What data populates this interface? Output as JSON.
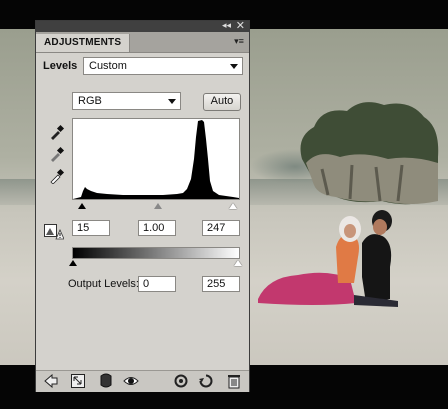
{
  "panel": {
    "tab_label": "ADJUSTMENTS",
    "titlebar_icons": [
      "collapse-icon",
      "close-icon"
    ],
    "menu_icon": "panel-menu-icon"
  },
  "levels": {
    "label": "Levels",
    "preset_value": "Custom",
    "channel_value": "RGB",
    "auto_label": "Auto",
    "input_black": "15",
    "input_gamma": "1.00",
    "input_white": "247",
    "output_label": "Output Levels:",
    "output_black": "0",
    "output_white": "255"
  },
  "tools": [
    "black-point-eyedropper-icon",
    "gray-point-eyedropper-icon",
    "white-point-eyedropper-icon",
    "clipping-warning-icon"
  ],
  "bottom_bar": [
    "return-to-list-icon",
    "expand-view-icon",
    "clip-to-layer-icon",
    "visibility-eye-icon",
    "previous-state-icon",
    "reset-icon",
    "trash-icon"
  ],
  "colors": {
    "panel_bg": "#d4d2cd",
    "titlebar": "#404040",
    "canvas_bg": "#050505"
  }
}
